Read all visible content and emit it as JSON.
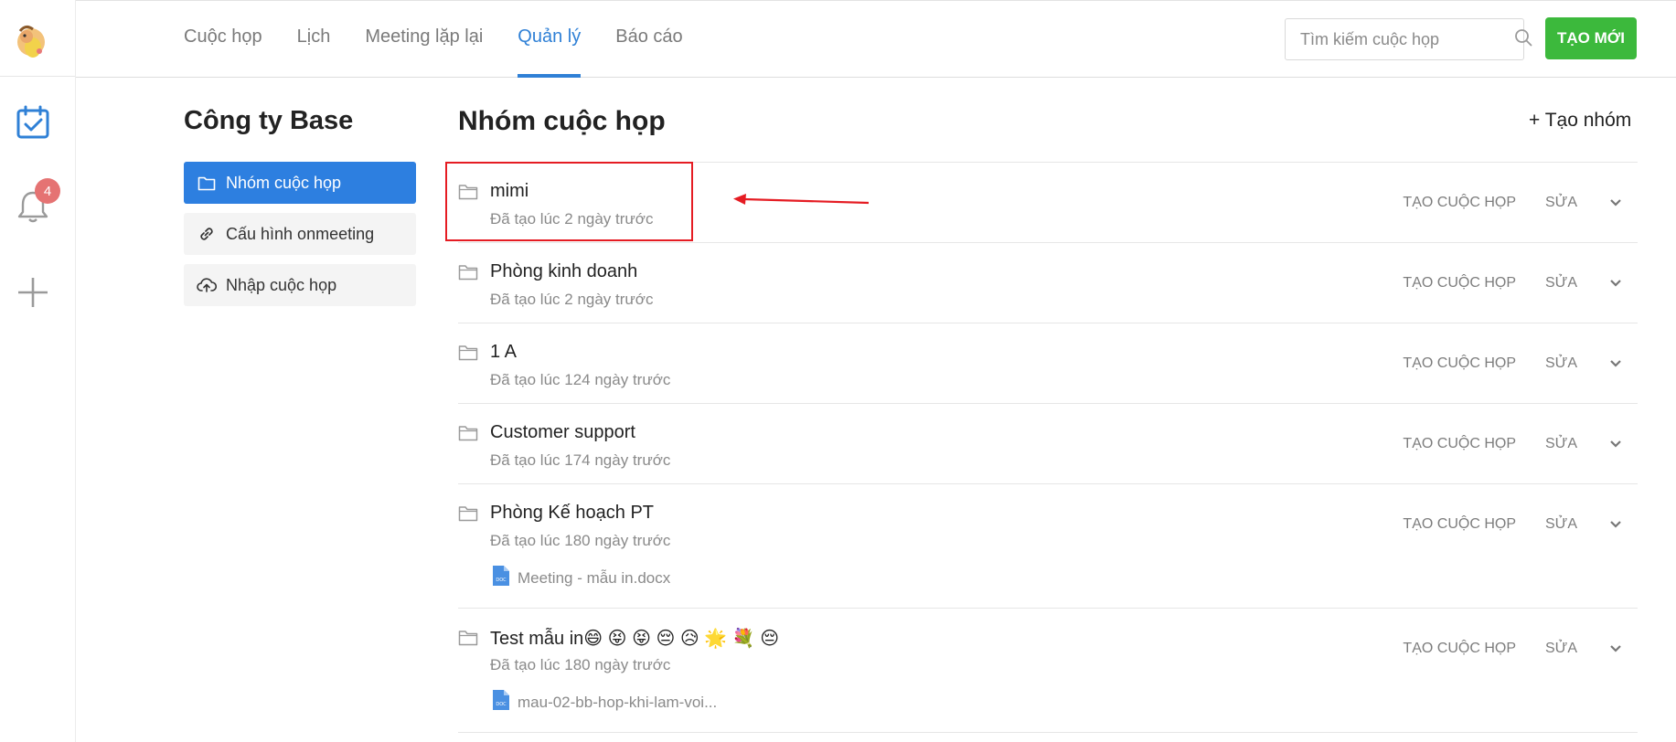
{
  "app": {
    "avatar": "avatar",
    "notification_count": "4"
  },
  "header": {
    "tabs": [
      {
        "label": "Cuộc họp",
        "active": false
      },
      {
        "label": "Lịch",
        "active": false
      },
      {
        "label": "Meeting lặp lại",
        "active": false
      },
      {
        "label": "Quản lý",
        "active": true
      },
      {
        "label": "Báo cáo",
        "active": false
      }
    ],
    "search_placeholder": "Tìm kiếm cuộc họp",
    "new_button": "TẠO MỚI"
  },
  "sidebar": {
    "company": "Công ty Base",
    "items": [
      {
        "label": "Nhóm cuộc họp",
        "icon": "folder-icon",
        "active": true
      },
      {
        "label": "Cấu hình onmeeting",
        "icon": "link-icon",
        "active": false
      },
      {
        "label": "Nhập cuộc họp",
        "icon": "cloud-upload-icon",
        "active": false
      }
    ]
  },
  "main": {
    "title": "Nhóm cuộc họp",
    "create_group": "+ Tạo nhóm",
    "action_create": "TẠO CUỘC HỌP",
    "action_edit": "SỬA",
    "groups": [
      {
        "name": "mimi",
        "meta": "Đã tạo lúc 2 ngày trước",
        "file": ""
      },
      {
        "name": "Phòng kinh doanh",
        "meta": "Đã tạo lúc 2 ngày trước",
        "file": ""
      },
      {
        "name": "1 A",
        "meta": "Đã tạo lúc 124 ngày trước",
        "file": ""
      },
      {
        "name": "Customer support",
        "meta": "Đã tạo lúc 174 ngày trước",
        "file": ""
      },
      {
        "name": "Phòng Kế hoạch PT",
        "meta": "Đã tạo lúc 180 ngày trước",
        "file": "Meeting - mẫu in.docx"
      },
      {
        "name": "Test mẫu in😄 😝 😝 😔 😥 🌟 💐 😔",
        "meta": "Đã tạo lúc 180 ngày trước",
        "file": "mau-02-bb-hop-khi-lam-voi..."
      }
    ]
  },
  "colors": {
    "accent": "#2f80d6",
    "primary_button": "#3cb93c",
    "annotation": "#e51c23",
    "badge": "#e57373"
  }
}
